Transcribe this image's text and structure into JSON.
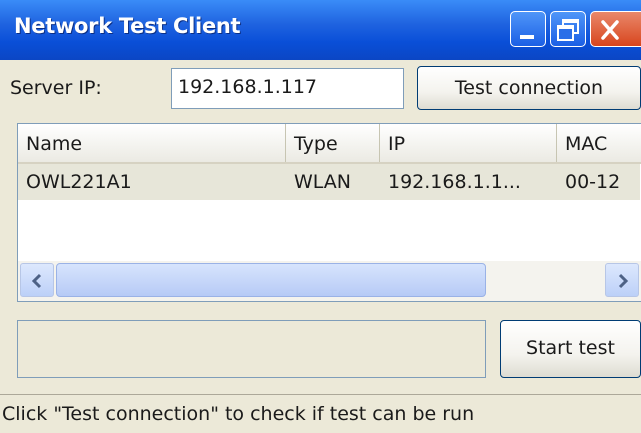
{
  "window": {
    "title": "Network Test Client",
    "controls": {
      "minimize": "minimize-icon",
      "maximize": "restore-icon",
      "close": "close-icon"
    }
  },
  "server": {
    "label": "Server IP:",
    "value": "192.168.1.117",
    "test_button": "Test connection"
  },
  "table": {
    "columns": [
      "Name",
      "Type",
      "IP",
      "MAC"
    ],
    "rows": [
      {
        "name": "OWL221A1",
        "type": "WLAN",
        "ip": "192.168.1.1...",
        "mac": "00-12"
      }
    ]
  },
  "actions": {
    "start_test": "Start test"
  },
  "progress": {
    "value": ""
  },
  "status": {
    "text": "Click \"Test connection\" to check if test can be run"
  },
  "colors": {
    "titlebar": "#0a4fd8",
    "window_bg": "#ece9d8",
    "close": "#d8451e"
  }
}
